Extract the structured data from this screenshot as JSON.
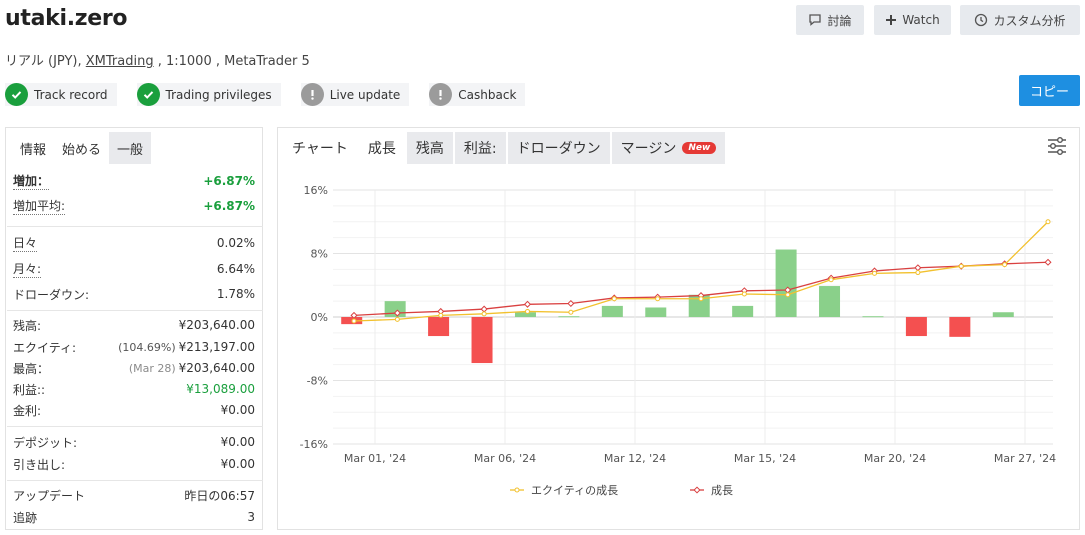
{
  "header": {
    "title": "utaki.zero",
    "subtitle_prefix": "リアル (JPY), ",
    "broker": "XMTrading",
    "subtitle_suffix": " , 1:1000 , MetaTrader 5",
    "discuss_label": "討論",
    "watch_label": "Watch",
    "analysis_label": "カスタム分析",
    "copy_label": "コピー"
  },
  "badges": [
    {
      "label": "Track record",
      "status": "ok",
      "icon": "check-circle-icon"
    },
    {
      "label": "Trading privileges",
      "status": "ok",
      "icon": "check-circle-icon"
    },
    {
      "label": "Live update",
      "status": "warn",
      "icon": "exclamation-circle-icon"
    },
    {
      "label": "Cashback",
      "status": "warn",
      "icon": "exclamation-circle-icon"
    }
  ],
  "left_tabs": [
    "情報",
    "始める",
    "一般"
  ],
  "stats": {
    "gain_label": "増加：",
    "gain": "+6.87%",
    "avg_gain_label": "増加平均:",
    "avg_gain": "+6.87%",
    "daily_label": "日々",
    "daily": "0.02%",
    "monthly_label": "月々:",
    "monthly": "6.64%",
    "drawdown_label": "ドローダウン:",
    "drawdown": "1.78%",
    "balance_label": "残高:",
    "balance": "¥203,640.00",
    "equity_label": "エクイティ:",
    "equity_pct": "(104.69%)",
    "equity": "¥213,197.00",
    "highest_label": "最高：",
    "highest_date": "(Mar 28)",
    "highest": "¥203,640.00",
    "profit_label": "利益::",
    "profit": "¥13,089.00",
    "interest_label": "金利:",
    "interest": "¥0.00",
    "deposits_label": "デポジット:",
    "deposits": "¥0.00",
    "withdrawals_label": "引き出し:",
    "withdrawals": "¥0.00",
    "updated_label": "アップデート",
    "updated": "昨日の06:57",
    "tracking_label": "追跡",
    "tracking": "3"
  },
  "right_tabs": [
    "チャート",
    "成長",
    "残高",
    "利益:",
    "ドローダウン",
    "マージン"
  ],
  "new_badge": "New",
  "colors": {
    "accent": "#1e8fe1",
    "positive": "#1a9f3d",
    "bar_pos": "#8ad08a",
    "bar_neg": "#f45050",
    "equity_line": "#f2c12e",
    "growth_line": "#d94040"
  },
  "chart_data": {
    "type": "bar+line",
    "x_tick_labels": [
      "Mar 01, '24",
      "Mar 06, '24",
      "Mar 12, '24",
      "Mar 15, '24",
      "Mar 20, '24",
      "Mar 27, '24"
    ],
    "y_tick_labels": [
      "16%",
      "8%",
      "0%",
      "-8%",
      "-16%"
    ],
    "ylim": [
      -16,
      16
    ],
    "bars": [
      -0.9,
      2.0,
      -2.4,
      -5.8,
      0.6,
      0.1,
      1.4,
      1.2,
      2.8,
      1.4,
      8.5,
      3.9,
      0.1,
      -2.4,
      -2.5,
      0.6
    ],
    "series": [
      {
        "name": "エクイティの成長",
        "values": [
          -0.5,
          -0.3,
          0.2,
          0.4,
          0.7,
          0.6,
          2.3,
          2.3,
          2.3,
          2.9,
          2.8,
          4.7,
          5.5,
          5.6,
          6.4,
          6.6,
          12.0
        ]
      },
      {
        "name": "成長",
        "values": [
          0.2,
          0.5,
          0.7,
          1.0,
          1.6,
          1.7,
          2.4,
          2.5,
          2.7,
          3.3,
          3.4,
          4.9,
          5.8,
          6.2,
          6.4,
          6.7,
          6.9
        ]
      }
    ],
    "grid": true,
    "legend": "bottom"
  }
}
